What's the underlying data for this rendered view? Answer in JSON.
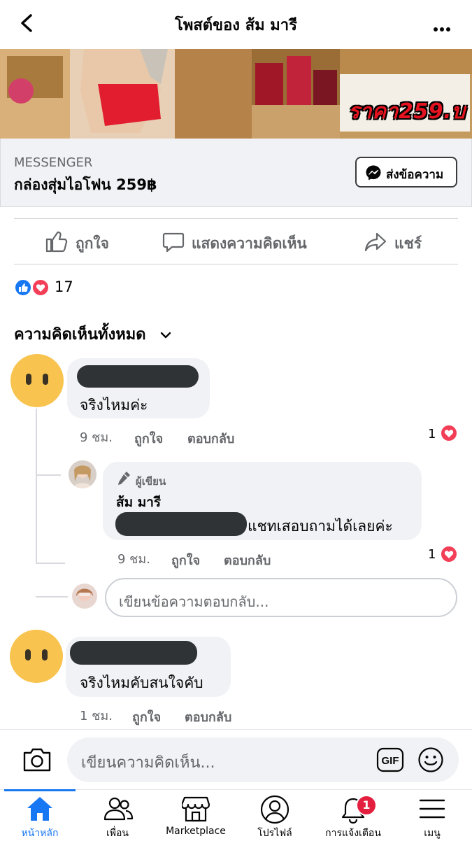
{
  "header": {
    "title": "โพสต์ของ ส้ม มารี"
  },
  "ad": {
    "price_label": "ราคา259.บ",
    "cta_label": "MESSENGER",
    "cta_title": "กล่องสุ่มไอโฟน 259฿",
    "cta_button": "ส่งข้อความ"
  },
  "actions": {
    "like": "ถูกใจ",
    "comment": "แสดงความคิดเห็น",
    "share": "แชร์"
  },
  "reactions": {
    "count": "17"
  },
  "comments_heading": "ความคิดเห็นทั้งหมด",
  "comments": [
    {
      "text": "จริงไหมค่ะ",
      "time": "9 ชม.",
      "like": "ถูกใจ",
      "reply": "ตอบกลับ",
      "reaction_count": "1",
      "replies": [
        {
          "badge": "ผู้เขียน",
          "author": "ส้ม มารี",
          "text": "แชทเสอบถามได้เลยค่ะ",
          "time": "9 ชม.",
          "like": "ถูกใจ",
          "reply": "ตอบกลับ",
          "reaction_count": "1"
        }
      ],
      "reply_placeholder": "เขียนข้อความตอบกลับ..."
    },
    {
      "text": "จริงไหมคับสนใจคับ",
      "time": "1 ชม.",
      "like": "ถูกใจ",
      "reply": "ตอบกลับ"
    }
  ],
  "composer": {
    "placeholder": "เขียนความคิดเห็น..."
  },
  "tabs": [
    {
      "label": "หน้าหลัก",
      "icon": "home-icon",
      "active": true
    },
    {
      "label": "เพื่อน",
      "icon": "friends-icon"
    },
    {
      "label": "Marketplace",
      "icon": "marketplace-icon"
    },
    {
      "label": "โปรไฟล์",
      "icon": "profile-icon"
    },
    {
      "label": "การแจ้งเตือน",
      "icon": "bell-icon",
      "badge": "1"
    },
    {
      "label": "เมนู",
      "icon": "menu-icon"
    }
  ],
  "colors": {
    "accent": "#1877f2",
    "love": "#f33e58",
    "price": "#e5131f"
  }
}
